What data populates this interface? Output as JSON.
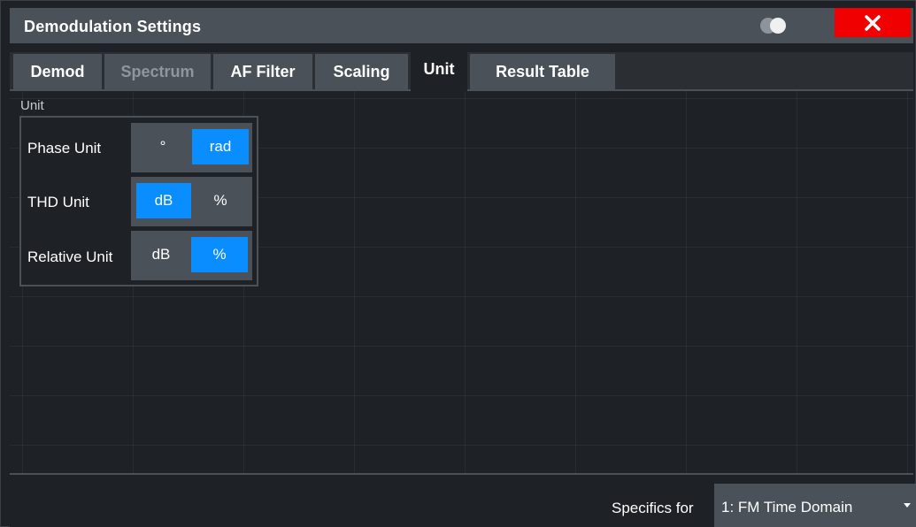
{
  "window": {
    "title": "Demodulation Settings"
  },
  "icons": {
    "toggle": "toggle-icon",
    "close": "close-icon",
    "dropdown": "chevron-down-icon"
  },
  "colors": {
    "titlebar": "#4a5159",
    "accent": "#0a8eff",
    "close": "#f00000",
    "background": "#1e2125"
  },
  "tabs": [
    {
      "label": "Demod",
      "state": "normal"
    },
    {
      "label": "Spectrum",
      "state": "disabled"
    },
    {
      "label": "AF Filter",
      "state": "normal"
    },
    {
      "label": "Scaling",
      "state": "normal"
    },
    {
      "label": "Unit",
      "state": "active"
    },
    {
      "label": "Result Table",
      "state": "normal"
    }
  ],
  "unit_group": {
    "label": "Unit",
    "rows": [
      {
        "label": "Phase Unit",
        "options": [
          "°",
          "rad"
        ],
        "selected": "rad"
      },
      {
        "label": "THD Unit",
        "options": [
          "dB",
          "%"
        ],
        "selected": "dB"
      },
      {
        "label": "Relative Unit",
        "options": [
          "dB",
          "%"
        ],
        "selected": "%"
      }
    ]
  },
  "footer": {
    "specifics_label": "Specifics for",
    "specifics_value": "1: FM Time Domain"
  }
}
